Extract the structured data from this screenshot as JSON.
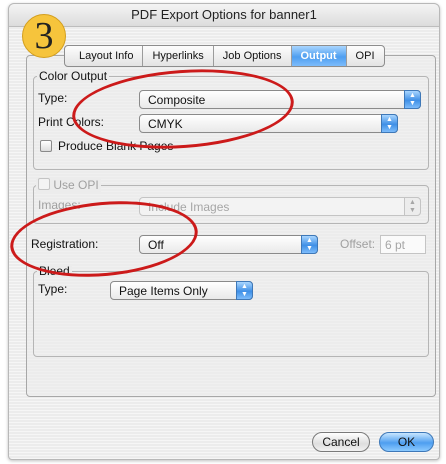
{
  "window": {
    "title": "PDF Export Options for banner1"
  },
  "step_badge": "3",
  "tabs": [
    {
      "label": "Layout Info",
      "active": false
    },
    {
      "label": "Hyperlinks",
      "active": false
    },
    {
      "label": "Job Options",
      "active": false
    },
    {
      "label": "Output",
      "active": true
    },
    {
      "label": "OPI",
      "active": false
    }
  ],
  "color_output": {
    "group_label": "Color Output",
    "type_label": "Type:",
    "type_value": "Composite",
    "print_colors_label": "Print Colors:",
    "print_colors_value": "CMYK",
    "produce_blank_pages_label": "Produce Blank Pages",
    "produce_blank_pages_checked": false
  },
  "opi": {
    "use_opi_label": "Use OPI",
    "use_opi_checked": false,
    "images_label": "Images:",
    "images_value": "Include Images"
  },
  "registration": {
    "label": "Registration:",
    "value": "Off",
    "offset_label": "Offset:",
    "offset_value": "6 pt"
  },
  "bleed": {
    "group_label": "Bleed",
    "type_label": "Type:",
    "type_value": "Page Items Only"
  },
  "buttons": {
    "cancel": "Cancel",
    "ok": "OK"
  },
  "colors": {
    "accent": "#4e9ef0",
    "annotation": "#cc1a1a",
    "badge": "#f6c43c"
  }
}
